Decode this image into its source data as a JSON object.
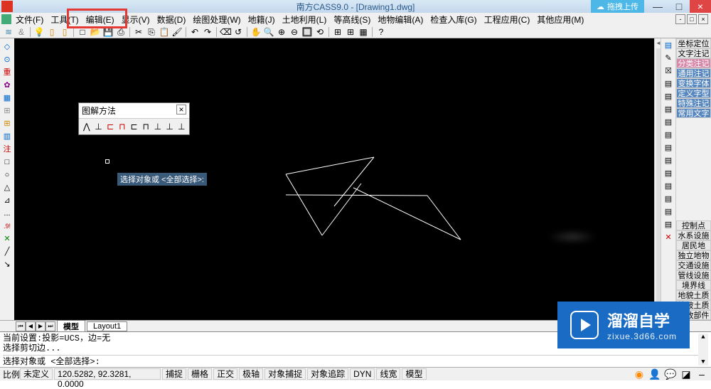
{
  "title": "南方CASS9.0 - [Drawing1.dwg]",
  "upload_button": "拖拽上传",
  "menus": {
    "file": "文件(F)",
    "tools": "工具(T)",
    "edit": "编辑(E)",
    "display": "显示(V)",
    "data": "数据(D)",
    "draw": "绘图处理(W)",
    "cadastre": "地籍(J)",
    "land": "土地利用(L)",
    "contour": "等高线(S)",
    "object_edit": "地物编辑(A)",
    "check": "检查入库(G)",
    "engineering": "工程应用(C)",
    "other": "其他应用(M)"
  },
  "floating_toolbar": {
    "title": "图解方法",
    "close": "×"
  },
  "tooltip": "选择对象或 <全部选择>:",
  "right_panel": {
    "coord": "坐标定位",
    "text_note": "文字注记",
    "class_note": "分类注记",
    "general_note": "通用注记",
    "change_font": "变换字体",
    "def_type": "定义字型",
    "special_note": "特殊注记",
    "common_text": "常用文字",
    "control": "控制点",
    "water": "水系设施",
    "residence": "居民地",
    "indep": "独立地物",
    "traffic": "交通设施",
    "pipeline": "管线设施",
    "boundary": "境界线",
    "landform": "地貌土质",
    "vegetation": "植被土质",
    "municipal": "市政部件"
  },
  "tabs": {
    "model": "模型",
    "layout1": "Layout1"
  },
  "command": {
    "line1": "当前设置:投影=UCS，边=无",
    "line2": "选择剪切边...",
    "line3": "选择对象或 <全部选择>:"
  },
  "status": {
    "scale": "比例",
    "undefined": "未定义",
    "coords": "120.5282, 92.3281, 0.0000",
    "snap": "捕捉",
    "grid": "栅格",
    "ortho": "正交",
    "polar": "极轴",
    "osnap": "对象捕捉",
    "otrack": "对象追踪",
    "dyn": "DYN",
    "lweight": "线宽",
    "model": "模型"
  },
  "watermark": {
    "title": "溜溜自学",
    "url": "zixue.3d66.com"
  },
  "left_icons": [
    "◇",
    "⊙",
    "重",
    "✿",
    "▦",
    "⊞",
    "⊞",
    "▥",
    "注",
    "□",
    "○",
    "△",
    "⊿",
    "...",
    ".9!",
    "✕",
    "╱",
    "↘"
  ],
  "right_icons": [
    "▤",
    "✎",
    "☒",
    "▤",
    "▤",
    "▤",
    "▤",
    "▤",
    "▤",
    "▤",
    "▤",
    "▤",
    "▤",
    "▤",
    "▤",
    "✕"
  ],
  "ft_icons": [
    "⋀",
    "⊥",
    "⊏",
    "⊓",
    "⊏",
    "⊓",
    "⊥",
    "⊥",
    "⊥"
  ]
}
